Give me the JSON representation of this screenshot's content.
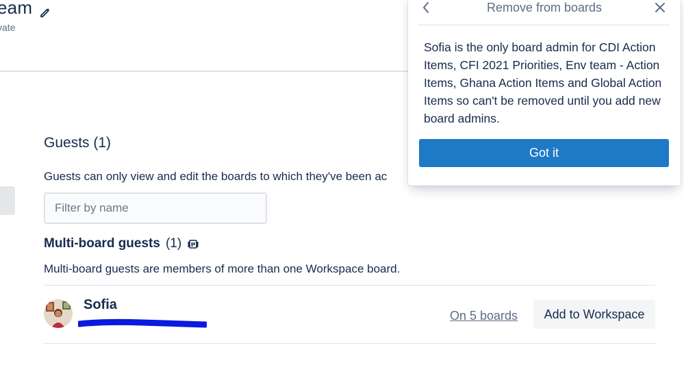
{
  "header": {
    "title": "eam",
    "visibility": "vate"
  },
  "guests": {
    "title": "Guests (1)",
    "description": "Guests can only view and edit the boards to which they've been ac",
    "filter": {
      "placeholder": "Filter by name",
      "value": ""
    },
    "multi_board": {
      "title": "Multi-board guests",
      "count": "(1)",
      "description": "Multi-board guests are members of more than one Workspace board."
    },
    "members": [
      {
        "name": "Sofia",
        "boards_link": "On 5 boards",
        "add_button": "Add to Workspace"
      }
    ]
  },
  "popover": {
    "title": "Remove from boards",
    "body": "Sofia is the only board admin for CDI Action Items, CFI 2021 Priorities, Env team - Action Items, Ghana Action Items and Global Action Items so can't be removed until you add new board admins.",
    "button": "Got it"
  },
  "colors": {
    "primary_button": "#1f7ac5",
    "text": "#172b4d",
    "muted": "#5e6c84",
    "redaction": "#0a1ae0"
  },
  "icons": {
    "edit": "pencil-icon",
    "boards": "boards-icon",
    "back": "chevron-left-icon",
    "close": "close-icon"
  }
}
